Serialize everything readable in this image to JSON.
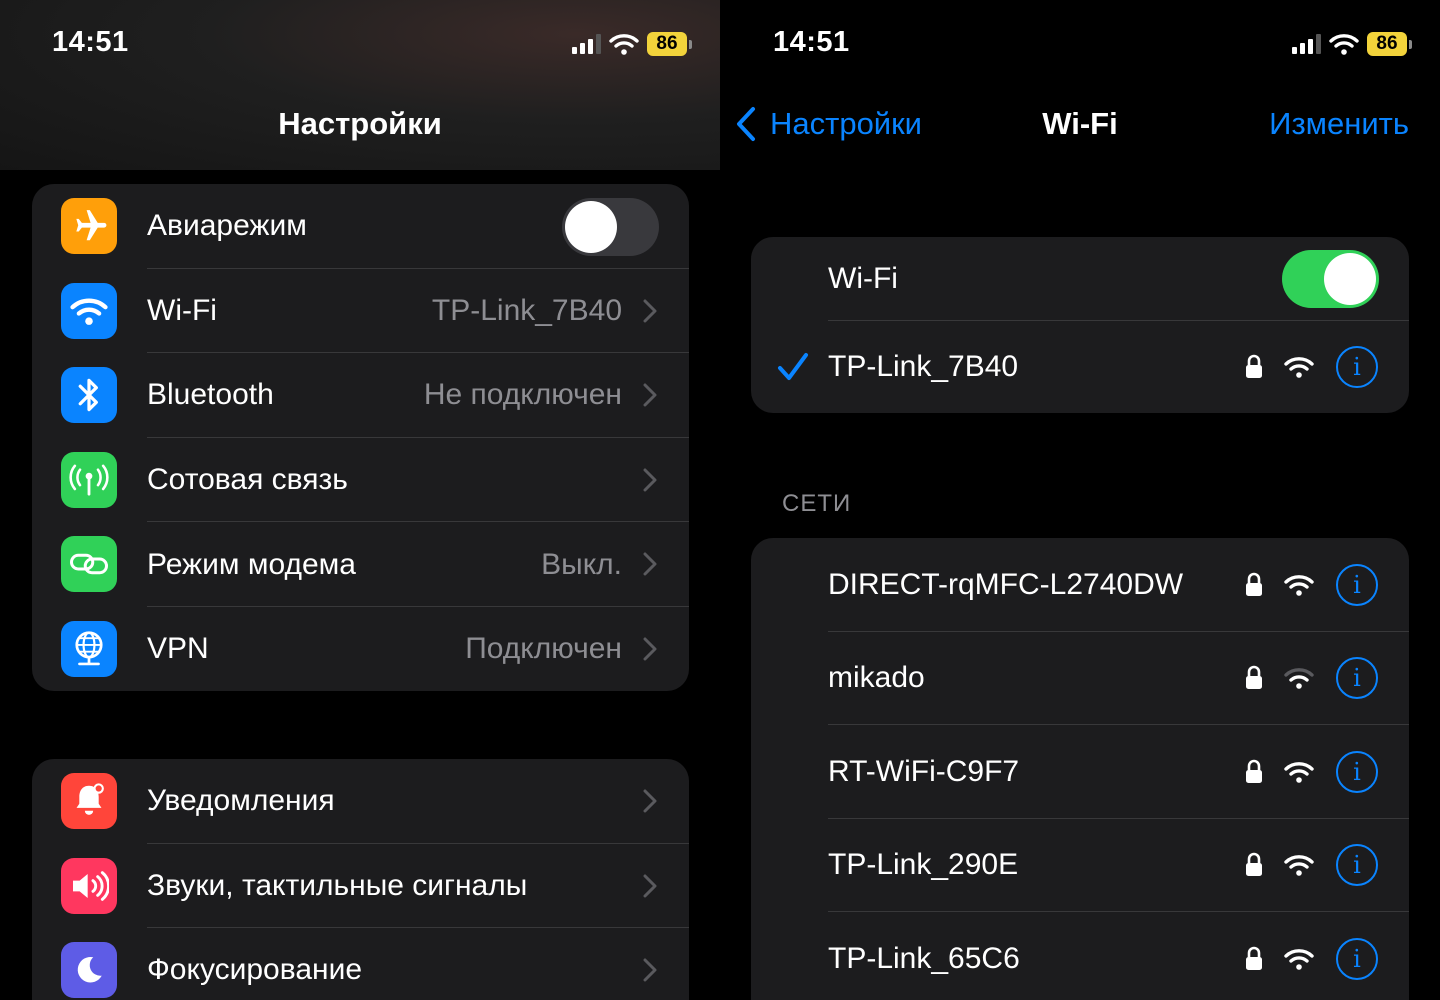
{
  "left": {
    "status": {
      "time": "14:51",
      "battery": "86"
    },
    "title": "Настройки",
    "group1": [
      {
        "label": "Авиарежим",
        "value": "",
        "icon": "airplane-icon",
        "color": "#ff9f0a",
        "toggle": false
      },
      {
        "label": "Wi-Fi",
        "value": "TP-Link_7B40",
        "icon": "wifi-icon",
        "color": "#0a84ff"
      },
      {
        "label": "Bluetooth",
        "value": "Не подключен",
        "icon": "bluetooth-icon",
        "color": "#0a84ff"
      },
      {
        "label": "Сотовая связь",
        "value": "",
        "icon": "cellular-icon",
        "color": "#30d158"
      },
      {
        "label": "Режим модема",
        "value": "Выкл.",
        "icon": "hotspot-icon",
        "color": "#30d158"
      },
      {
        "label": "VPN",
        "value": "Подключен",
        "icon": "vpn-globe-icon",
        "color": "#0a84ff"
      }
    ],
    "group2": [
      {
        "label": "Уведомления",
        "icon": "notifications-bell-icon",
        "color": "#ff453a"
      },
      {
        "label": "Звуки, тактильные сигналы",
        "icon": "speaker-icon",
        "color": "#ff375f"
      },
      {
        "label": "Фокусирование",
        "icon": "moon-icon",
        "color": "#5e5ce6"
      }
    ]
  },
  "right": {
    "status": {
      "time": "14:51",
      "battery": "86"
    },
    "nav": {
      "back": "Настройки",
      "title": "Wi-Fi",
      "edit": "Изменить"
    },
    "wifi_toggle": {
      "label": "Wi-Fi",
      "on": true
    },
    "connected": {
      "name": "TP-Link_7B40"
    },
    "networks_header": "СЕТИ",
    "networks": [
      {
        "name": "DIRECT-rqMFC-L2740DW",
        "signal": 3
      },
      {
        "name": "mikado",
        "signal": 2
      },
      {
        "name": "RT-WiFi-C9F7",
        "signal": 3
      },
      {
        "name": "TP-Link_290E",
        "signal": 3
      },
      {
        "name": "TP-Link_65C6",
        "signal": 3
      }
    ]
  }
}
